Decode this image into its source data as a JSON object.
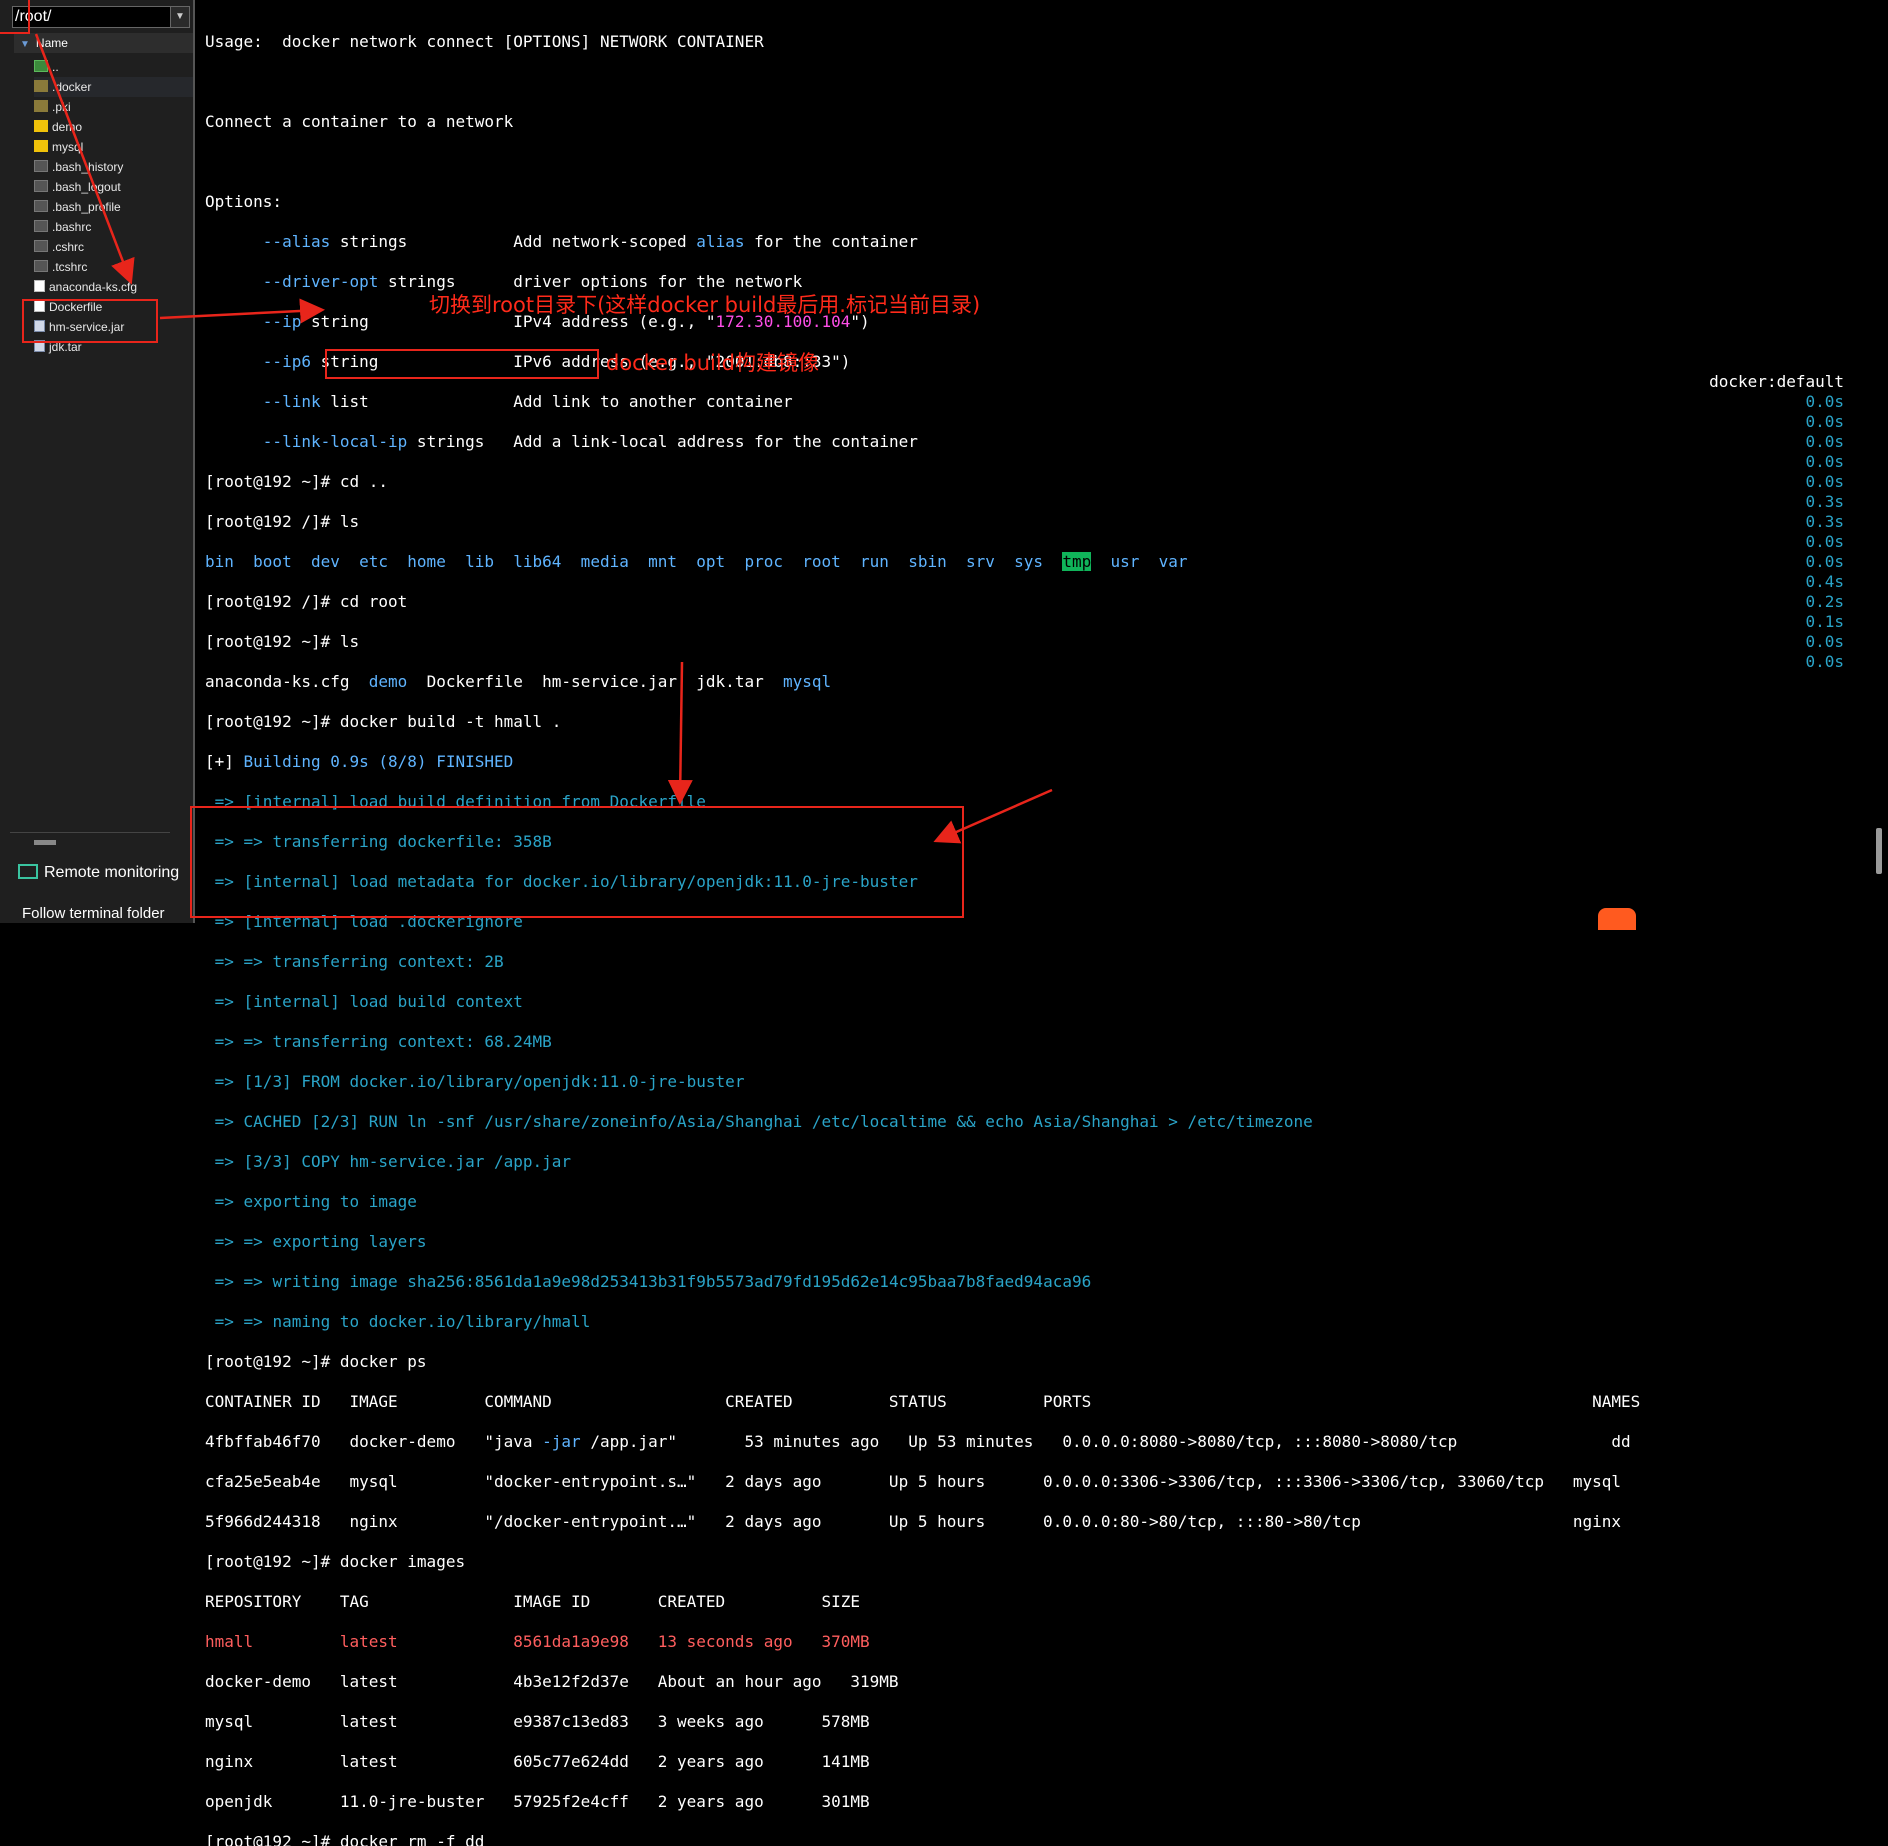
{
  "sidebar": {
    "path": "/root/",
    "column_name": "Name",
    "files": [
      {
        "name": "..",
        "icon": "parent-folder-icon"
      },
      {
        "name": ".docker",
        "icon": "folder-icon",
        "selected": true
      },
      {
        "name": ".pki",
        "icon": "folder-icon"
      },
      {
        "name": "demo",
        "icon": "folder-icon"
      },
      {
        "name": "mysql",
        "icon": "folder-icon"
      },
      {
        "name": ".bash_history",
        "icon": "file-icon"
      },
      {
        "name": ".bash_logout",
        "icon": "file-icon"
      },
      {
        "name": ".bash_profile",
        "icon": "file-icon"
      },
      {
        "name": ".bashrc",
        "icon": "file-icon"
      },
      {
        "name": ".cshrc",
        "icon": "file-icon"
      },
      {
        "name": ".tcshrc",
        "icon": "file-icon"
      },
      {
        "name": "anaconda-ks.cfg",
        "icon": "config-file-icon"
      },
      {
        "name": "Dockerfile",
        "icon": "document-icon"
      },
      {
        "name": "hm-service.jar",
        "icon": "jar-file-icon"
      },
      {
        "name": "jdk.tar",
        "icon": "archive-file-icon"
      }
    ],
    "remote_monitoring": "Remote monitoring",
    "follow_folder": "Follow terminal folder"
  },
  "terminal": {
    "usage": "Usage:  docker network connect [OPTIONS] NETWORK CONTAINER",
    "description": "Connect a container to a network",
    "options_header": "Options:",
    "opt1_flag": "--alias",
    "opt1_type": " strings           ",
    "opt1_pre": "Add network-scoped ",
    "opt1_word": "alias",
    "opt1_post": " for the container",
    "opt2_flag": "--driver-opt",
    "opt2_type": " strings      ",
    "opt2_desc": "driver options for the network",
    "opt3_flag": "--ip",
    "opt3_type": " string               ",
    "opt3_pre": "IPv4 address (e.g., \"",
    "opt3_ip": "172.30.100.104",
    "opt3_post": "\")",
    "opt4_flag": "--ip6",
    "opt4_type": " string              ",
    "opt4_desc": "IPv6 address (e.g., \"2001:db8::33\")",
    "opt5_flag": "--link",
    "opt5_type": " list               ",
    "opt5_desc": "Add link to another container",
    "opt6_flag": "--link-local-ip",
    "opt6_type": " strings   ",
    "opt6_desc": "Add a link-local address for the container",
    "cmd_cd_up": "[root@192 ~]# cd ..",
    "cmd_ls1": "[root@192 /]# ls",
    "ls_root_dirs_a": "bin  boot  dev  etc  home  lib  lib64  media  mnt  opt  proc  root  run  sbin  srv  sys  ",
    "ls_root_tmp": "tmp",
    "ls_root_dirs_b": "  usr  var",
    "cmd_cd_root": "[root@192 /]# cd root",
    "cmd_ls2": "[root@192 ~]# ls",
    "ls_home_a": "anaconda-ks.cfg  ",
    "ls_home_demo": "demo",
    "ls_home_b": "  Dockerfile  hm-service.jar  jdk.tar  ",
    "ls_home_mysql": "mysql",
    "cmd_build": "[root@192 ~]# docker build -t hmall .",
    "build_head_a": "[+] ",
    "build_head_b": "Building 0.9s (8/8) FINISHED",
    "build_builder": "docker:default",
    "build_steps": [
      "=> [internal] load build definition from Dockerfile",
      "=> => transferring dockerfile: 358B",
      "=> [internal] load metadata for docker.io/library/openjdk:11.0-jre-buster",
      "=> [internal] load .dockerignore",
      "=> => transferring context: 2B",
      "=> [internal] load build context",
      "=> => transferring context: 68.24MB",
      "=> [1/3] FROM docker.io/library/openjdk:11.0-jre-buster",
      "=> CACHED [2/3] RUN ln -snf /usr/share/zoneinfo/Asia/Shanghai /etc/localtime && echo Asia/Shanghai > /etc/timezone",
      "=> [3/3] COPY hm-service.jar /app.jar",
      "=> exporting to image",
      "=> => exporting layers",
      "=> => writing image sha256:8561da1a9e98d253413b31f9b5573ad79fd195d62e14c95baa7b8faed94aca96",
      "=> => naming to docker.io/library/hmall"
    ],
    "build_times": [
      "0.0s",
      "0.0s",
      "0.0s",
      "0.0s",
      "0.0s",
      "0.3s",
      "0.3s",
      "0.0s",
      "0.0s",
      "0.4s",
      "0.2s",
      "0.1s",
      "0.0s",
      "0.0s"
    ],
    "cmd_ps": "[root@192 ~]# docker ps",
    "ps_header": "CONTAINER ID   IMAGE         COMMAND                  CREATED          STATUS          PORTS                                                    NAMES",
    "ps_row1_a": "4fbffab46f70   docker-demo   \"java ",
    "ps_row1_jar": "-jar",
    "ps_row1_b": " /app.jar\"       53 minutes ago   Up 53 minutes   0.0.0.0:8080->8080/tcp, :::8080->8080/tcp                dd",
    "ps_row2": "cfa25e5eab4e   mysql         \"docker-entrypoint.s…\"   2 days ago       Up 5 hours      0.0.0.0:3306->3306/tcp, :::3306->3306/tcp, 33060/tcp   mysql",
    "ps_row3": "5f966d244318   nginx         \"/docker-entrypoint.…\"   2 days ago       Up 5 hours      0.0.0.0:80->80/tcp, :::80->80/tcp                      nginx",
    "cmd_images": "[root@192 ~]# docker images",
    "images_header": "REPOSITORY    TAG               IMAGE ID       CREATED          SIZE",
    "images_rows": [
      "hmall         latest            8561da1a9e98   13 seconds ago   370MB",
      "docker-demo   latest            4b3e12f2d37e   About an hour ago   319MB",
      "mysql         latest            e9387c13ed83   3 weeks ago      578MB",
      "nginx         latest            605c77e624dd   2 years ago      141MB",
      "openjdk       11.0-jre-buster   57925f2e4cff   2 years ago      301MB"
    ],
    "cmd_rm_partial": "[root@192 ~]# docker rm -f dd"
  },
  "annotations": {
    "cd_root_note": "切换到root目录下(这样docker build最后用.标记当前目录)",
    "build_note": "docker build构建镜像"
  },
  "colors": {
    "annotation": "#e8251b",
    "prompt_blue": "#5fb4ff",
    "build_cyan": "#2aa4c8",
    "highlight_pink": "#ff4fe8",
    "new_image_red": "#ff5e5e"
  }
}
